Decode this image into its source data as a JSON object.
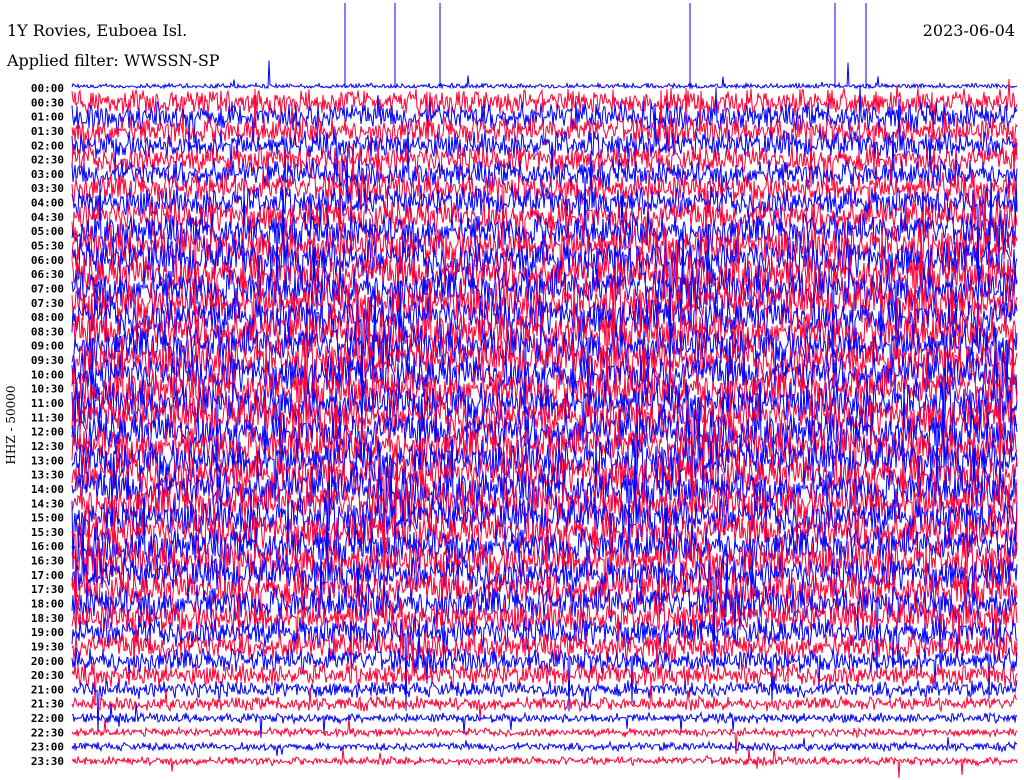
{
  "header": {
    "title": "1Y Rovies, Euboea Isl.",
    "filter": "Applied filter: WWSSN-SP",
    "date": "2023-06-04"
  },
  "chart_data": {
    "type": "line",
    "title": "1Y Rovies, Euboea Isl.",
    "subtitle": "Applied filter: WWSSN-SP",
    "date": "2023-06-04",
    "ylabel": "HHZ - 50000",
    "xlabel": "",
    "row_minutes": 30,
    "row_labels": [
      "00:00",
      "00:30",
      "01:00",
      "01:30",
      "02:00",
      "02:30",
      "03:00",
      "03:30",
      "04:00",
      "04:30",
      "05:00",
      "05:30",
      "06:00",
      "06:30",
      "07:00",
      "07:30",
      "08:00",
      "08:30",
      "09:00",
      "09:30",
      "10:00",
      "10:30",
      "11:00",
      "11:30",
      "12:00",
      "12:30",
      "13:00",
      "13:30",
      "14:00",
      "14:30",
      "15:00",
      "15:30",
      "16:00",
      "16:30",
      "17:00",
      "17:30",
      "18:00",
      "18:30",
      "19:00",
      "19:30",
      "20:00",
      "20:30",
      "21:00",
      "21:30",
      "22:00",
      "22:30",
      "23:00",
      "23:30"
    ],
    "series_colors": [
      "#0000ff",
      "#ff0033"
    ],
    "relative_amplitude": [
      0.4,
      0.9,
      1,
      1,
      1,
      1,
      1,
      1.1,
      1.1,
      1.2,
      1.3,
      1.4,
      1.5,
      1.5,
      1.5,
      1.5,
      1.5,
      1.5,
      1.5,
      1.5,
      1.5,
      1.5,
      1.5,
      1.5,
      1.5,
      1.5,
      1.5,
      1.5,
      1.5,
      1.5,
      1.4,
      1.4,
      1.4,
      1.4,
      1.3,
      1.3,
      1.3,
      1.2,
      1.1,
      1,
      0.9,
      0.8,
      0.6,
      0.5,
      0.35,
      0.3,
      0.3,
      0.3
    ]
  }
}
